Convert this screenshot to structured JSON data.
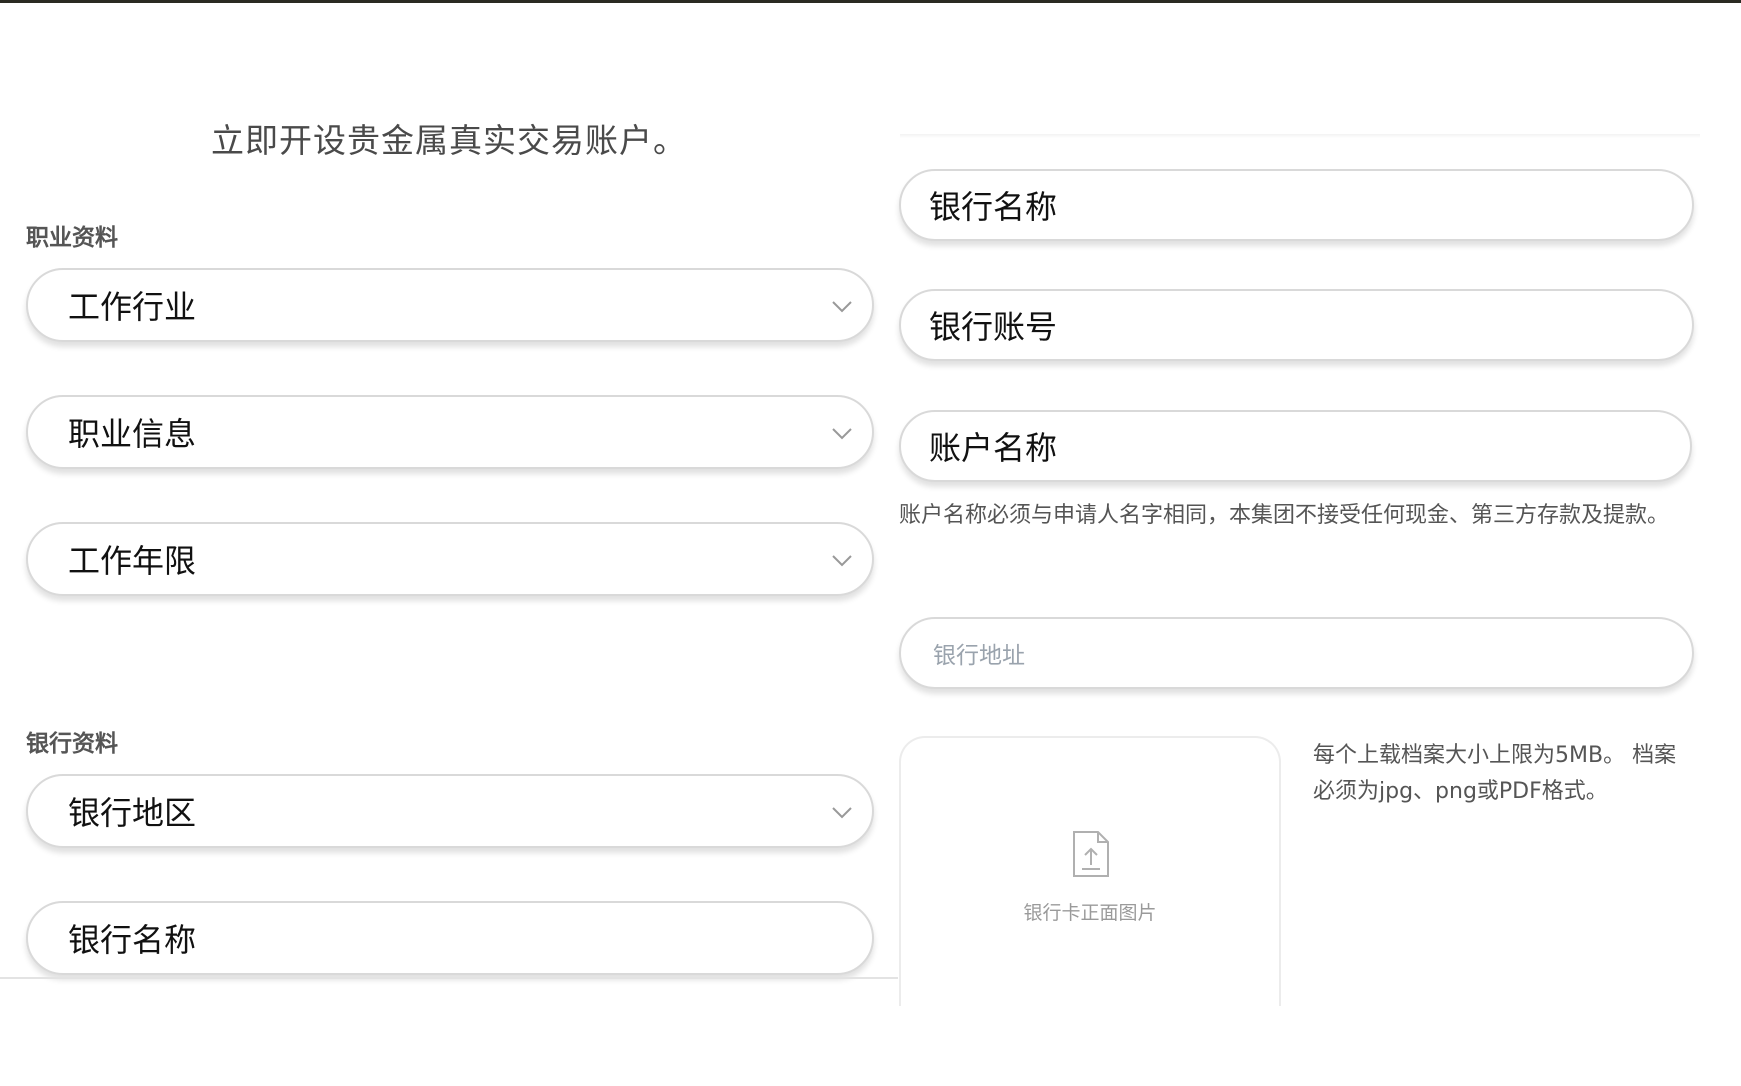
{
  "page_title": "立即开设贵金属真实交易账户。",
  "sections": {
    "occupation": "职业资料",
    "bank": "银行资料"
  },
  "left_fields": {
    "industry": "工作行业",
    "occupation_info": "职业信息",
    "work_years": "工作年限",
    "bank_region": "银行地区",
    "bank_name": "银行名称"
  },
  "right_fields": {
    "bank_name": "银行名称",
    "bank_account": "银行账号",
    "account_name": "账户名称",
    "account_name_note": "账户名称必须与申请人名字相同，本集团不接受任何现金、第三方存款及提款。",
    "bank_address_placeholder": "银行地址"
  },
  "upload": {
    "label": "银行卡正面图片",
    "note": "每个上载档案大小上限为5MB。 档案必须为jpg、png或PDF格式。"
  },
  "icons": {
    "dropdown": "chevron-down-icon",
    "upload": "file-upload-icon"
  }
}
